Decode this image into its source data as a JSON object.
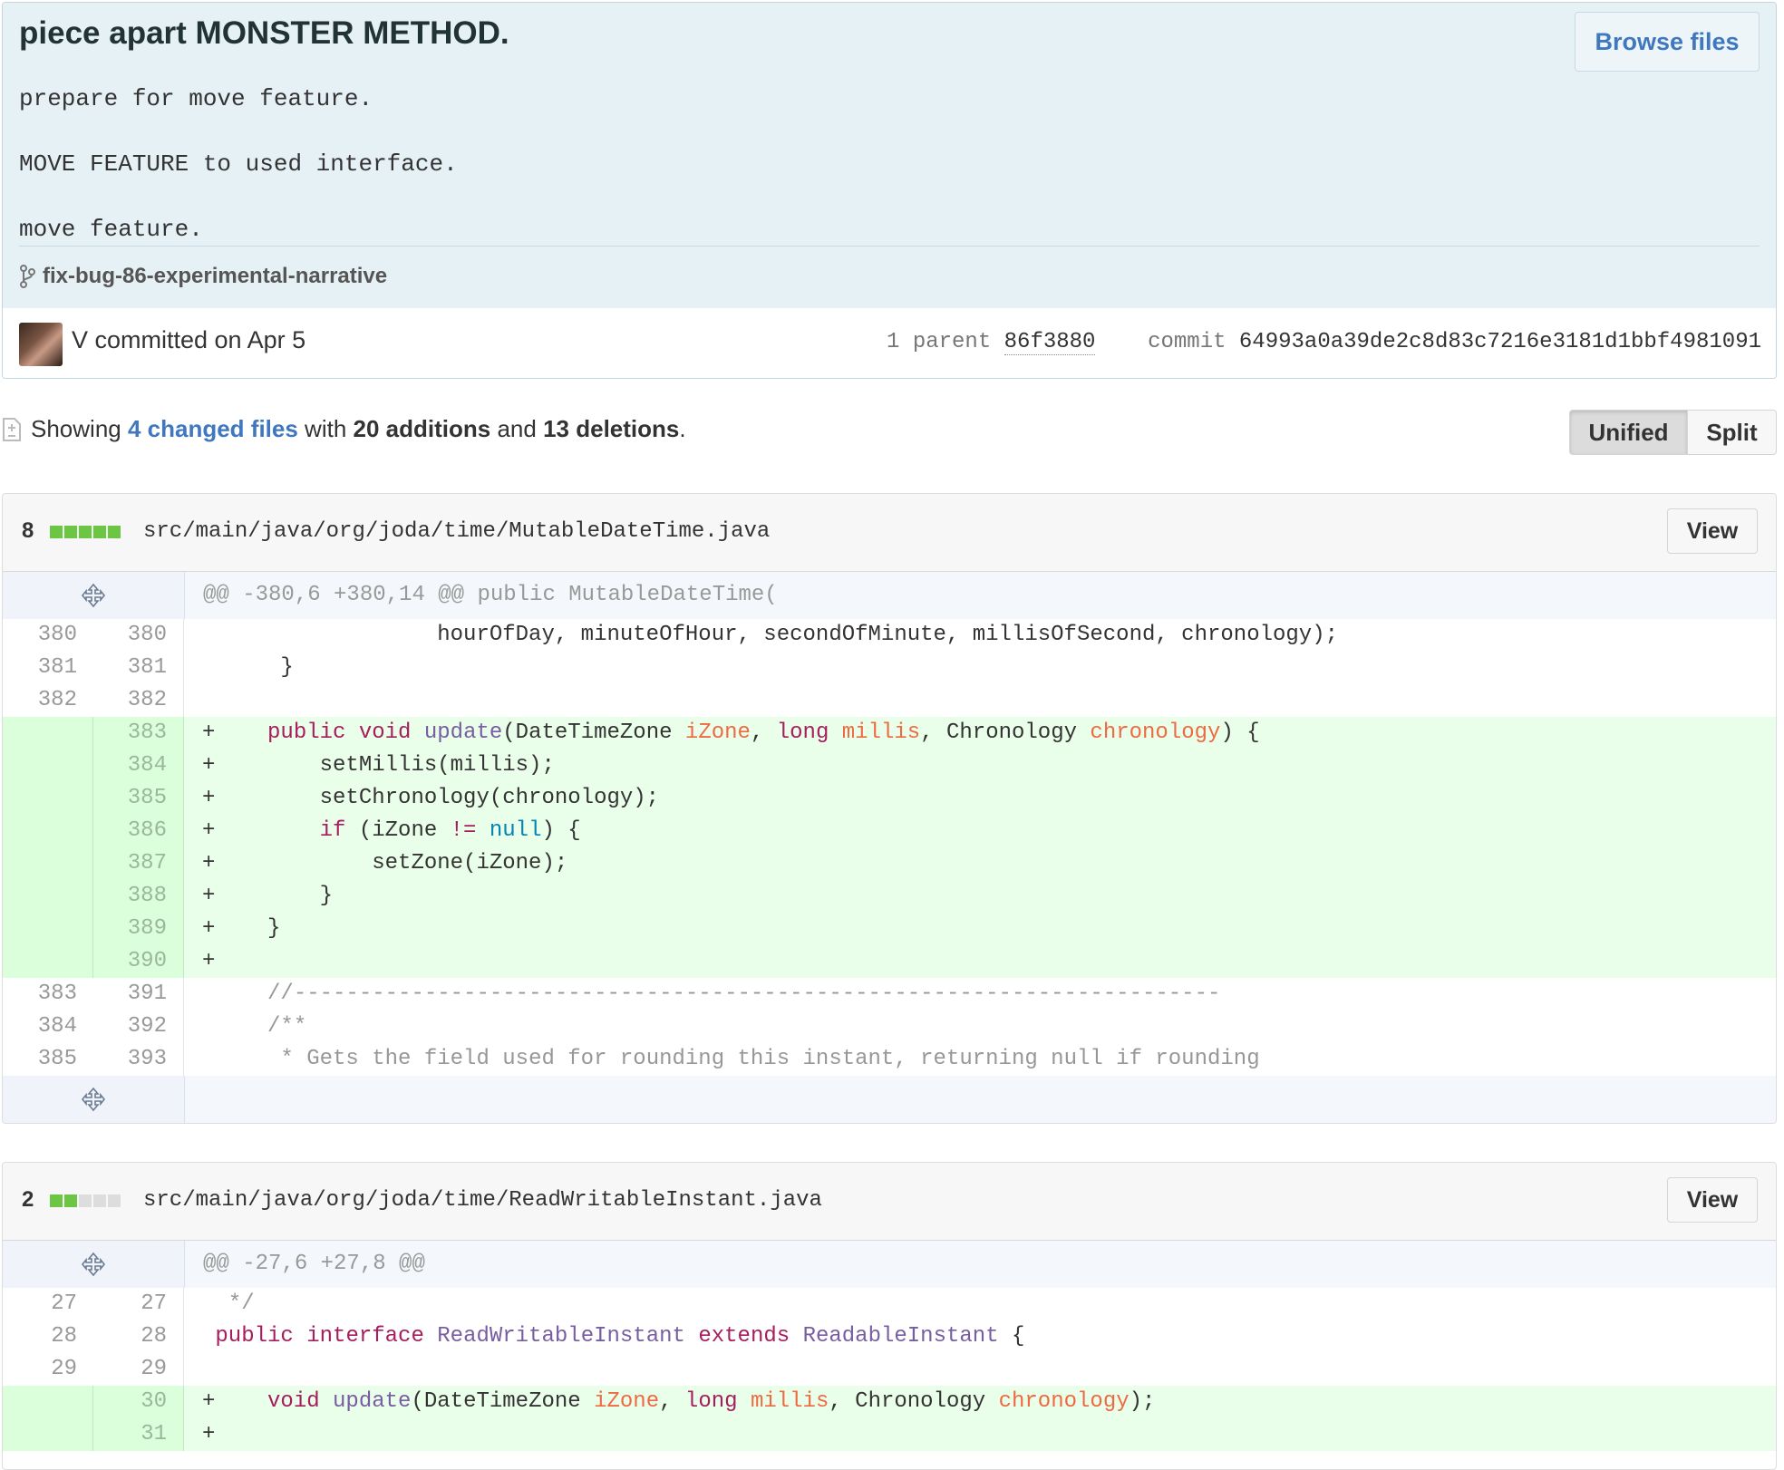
{
  "commit": {
    "title": "piece apart MONSTER METHOD.",
    "browse_label": "Browse files",
    "description": "prepare for move feature.\nMOVE FEATURE to used interface.\nmove feature.",
    "branch": "fix-bug-86-experimental-narrative",
    "author_line": "V committed on Apr 5",
    "parent_label": "1 parent",
    "parent_sha": "86f3880",
    "commit_label": "commit",
    "commit_sha": "64993a0a39de2c8d83c7216e3181d1bbf4981091"
  },
  "summary": {
    "showing": "Showing",
    "changed_files": "4 changed files",
    "with": "with",
    "additions": "20 additions",
    "and": "and",
    "deletions": "13 deletions",
    "period": ".",
    "unified_label": "Unified",
    "split_label": "Split"
  },
  "colors": {
    "addition": "#6cc644",
    "add_bg": "#eaffea",
    "link": "#4078c0",
    "keyword": "#a71d5d",
    "function": "#795da3",
    "param": "#ed6a43"
  },
  "files": [
    {
      "count": "8",
      "blocks": [
        "add",
        "add",
        "add",
        "add",
        "add"
      ],
      "path": "src/main/java/org/joda/time/MutableDateTime.java",
      "view_label": "View",
      "hunk": "@@ -380,6 +380,14 @@ public MutableDateTime(",
      "lines": [
        {
          "type": "ctx",
          "old": "380",
          "new": "380",
          "tokens": [
            {
              "t": "                  hourOfDay, minuteOfHour, secondOfMinute, millisOfSecond, chronology);"
            }
          ]
        },
        {
          "type": "ctx",
          "old": "381",
          "new": "381",
          "tokens": [
            {
              "t": "      }"
            }
          ]
        },
        {
          "type": "ctx",
          "old": "382",
          "new": "382",
          "tokens": [
            {
              "t": ""
            }
          ]
        },
        {
          "type": "add",
          "old": "",
          "new": "383",
          "tokens": [
            {
              "t": "+    "
            },
            {
              "t": "public",
              "c": "kw"
            },
            {
              "t": " "
            },
            {
              "t": "void",
              "c": "kw"
            },
            {
              "t": " "
            },
            {
              "t": "update",
              "c": "fn"
            },
            {
              "t": "(DateTimeZone "
            },
            {
              "t": "iZone",
              "c": "pa"
            },
            {
              "t": ", "
            },
            {
              "t": "long",
              "c": "kw"
            },
            {
              "t": " "
            },
            {
              "t": "millis",
              "c": "pa"
            },
            {
              "t": ", Chronology "
            },
            {
              "t": "chronology",
              "c": "pa"
            },
            {
              "t": ") {"
            }
          ]
        },
        {
          "type": "add",
          "old": "",
          "new": "384",
          "tokens": [
            {
              "t": "+        setMillis(millis);"
            }
          ]
        },
        {
          "type": "add",
          "old": "",
          "new": "385",
          "tokens": [
            {
              "t": "+        setChronology(chronology);"
            }
          ]
        },
        {
          "type": "add",
          "old": "",
          "new": "386",
          "tokens": [
            {
              "t": "+        "
            },
            {
              "t": "if",
              "c": "kw"
            },
            {
              "t": " (iZone "
            },
            {
              "t": "!=",
              "c": "kw"
            },
            {
              "t": " "
            },
            {
              "t": "null",
              "c": "cn"
            },
            {
              "t": ") {"
            }
          ]
        },
        {
          "type": "add",
          "old": "",
          "new": "387",
          "tokens": [
            {
              "t": "+            setZone(iZone);"
            }
          ]
        },
        {
          "type": "add",
          "old": "",
          "new": "388",
          "tokens": [
            {
              "t": "+        }"
            }
          ]
        },
        {
          "type": "add",
          "old": "",
          "new": "389",
          "tokens": [
            {
              "t": "+    }"
            }
          ]
        },
        {
          "type": "add",
          "old": "",
          "new": "390",
          "tokens": [
            {
              "t": "+"
            }
          ]
        },
        {
          "type": "ctx",
          "old": "383",
          "new": "391",
          "tokens": [
            {
              "t": "     "
            },
            {
              "t": "//-----------------------------------------------------------------------",
              "c": "cm"
            }
          ]
        },
        {
          "type": "ctx",
          "old": "384",
          "new": "392",
          "tokens": [
            {
              "t": "     "
            },
            {
              "t": "/**",
              "c": "cm"
            }
          ]
        },
        {
          "type": "ctx",
          "old": "385",
          "new": "393",
          "tokens": [
            {
              "t": "      "
            },
            {
              "t": "* Gets the field used for rounding this instant, returning null if rounding",
              "c": "cm"
            }
          ]
        }
      ],
      "has_footer": true
    },
    {
      "count": "2",
      "blocks": [
        "add",
        "add",
        "neu",
        "neu",
        "neu"
      ],
      "path": "src/main/java/org/joda/time/ReadWritableInstant.java",
      "view_label": "View",
      "hunk": "@@ -27,6 +27,8 @@",
      "lines": [
        {
          "type": "ctx",
          "old": "27",
          "new": "27",
          "tokens": [
            {
              "t": "  "
            },
            {
              "t": "*/",
              "c": "cm"
            }
          ]
        },
        {
          "type": "ctx",
          "old": "28",
          "new": "28",
          "tokens": [
            {
              "t": " "
            },
            {
              "t": "public",
              "c": "kw"
            },
            {
              "t": " "
            },
            {
              "t": "interface",
              "c": "kw"
            },
            {
              "t": " "
            },
            {
              "t": "ReadWritableInstant",
              "c": "fn"
            },
            {
              "t": " "
            },
            {
              "t": "extends",
              "c": "kw"
            },
            {
              "t": " "
            },
            {
              "t": "ReadableInstant",
              "c": "fn"
            },
            {
              "t": " {"
            }
          ]
        },
        {
          "type": "ctx",
          "old": "29",
          "new": "29",
          "tokens": [
            {
              "t": ""
            }
          ]
        },
        {
          "type": "add",
          "old": "",
          "new": "30",
          "tokens": [
            {
              "t": "+    "
            },
            {
              "t": "void",
              "c": "kw"
            },
            {
              "t": " "
            },
            {
              "t": "update",
              "c": "fn"
            },
            {
              "t": "(DateTimeZone "
            },
            {
              "t": "iZone",
              "c": "pa"
            },
            {
              "t": ", "
            },
            {
              "t": "long",
              "c": "kw"
            },
            {
              "t": " "
            },
            {
              "t": "millis",
              "c": "pa"
            },
            {
              "t": ", Chronology "
            },
            {
              "t": "chronology",
              "c": "pa"
            },
            {
              "t": ");"
            }
          ]
        },
        {
          "type": "add",
          "old": "",
          "new": "31",
          "tokens": [
            {
              "t": "+"
            }
          ]
        }
      ],
      "has_footer": false
    }
  ]
}
